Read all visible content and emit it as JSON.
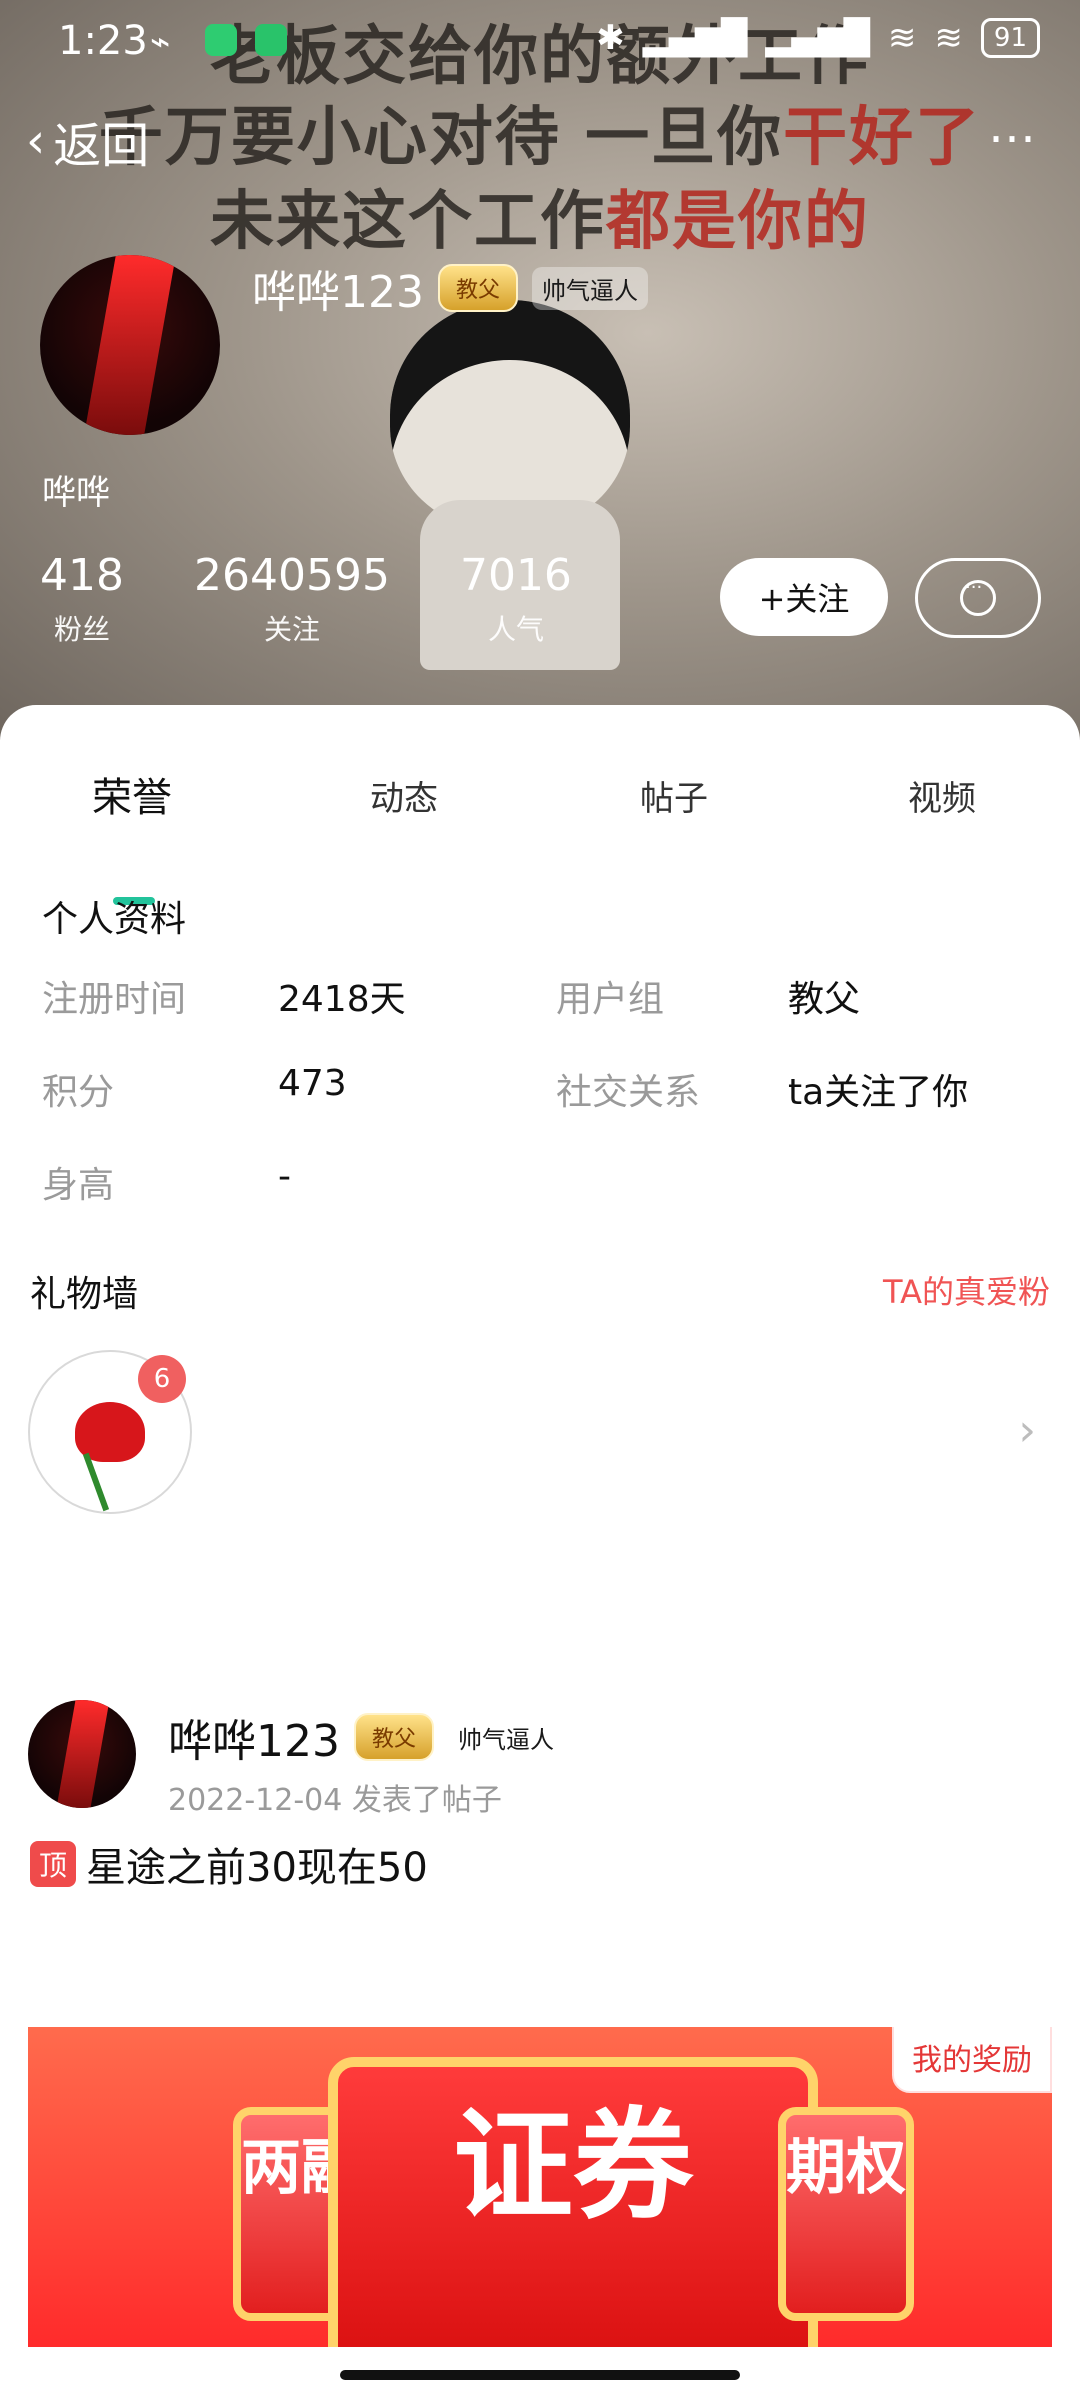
{
  "status_bar": {
    "time": "1:23",
    "battery": "91"
  },
  "nav": {
    "back_label": "返回",
    "more_label": "⋯"
  },
  "hero_text": {
    "line1": "老板交给你的额外工作",
    "line2_a": "千万要小心对待 一旦你",
    "line2_b": "干好了",
    "line3_a": "未来这个工作",
    "line3_b": "都是你的"
  },
  "profile": {
    "nickname": "哗哗123",
    "badge": "教父",
    "ink_badge": "帅气逼人",
    "small_name": "哗哗",
    "stats": [
      {
        "num": "418",
        "label": "粉丝"
      },
      {
        "num": "2640595",
        "label": "关注"
      },
      {
        "num": "7016",
        "label": "人气"
      }
    ],
    "follow_label": "+关注"
  },
  "tabs": {
    "items": [
      "荣誉",
      "动态",
      "帖子",
      "视频"
    ],
    "active_index": 0
  },
  "personal_info": {
    "title": "个人资料",
    "rows": [
      {
        "k": "注册时间",
        "v": "2418天",
        "k2": "用户组",
        "v2": "教父"
      },
      {
        "k": "积分",
        "v": "473",
        "k2": "社交关系",
        "v2": "ta关注了你"
      },
      {
        "k": "身高",
        "v": "-",
        "k2": "",
        "v2": ""
      }
    ]
  },
  "gift_wall": {
    "title": "礼物墙",
    "link": "TA的真爱粉",
    "count": "6"
  },
  "post": {
    "author": "哗哗123",
    "badge": "教父",
    "ink_badge": "帅气逼人",
    "meta": "2022-12-04  发表了帖子",
    "pin_label": "顶",
    "text": "星途之前30现在50"
  },
  "banner": {
    "reward_label": "我的奖励",
    "center_big": "证券",
    "left_side": "两融",
    "right_side": "期权"
  },
  "colors": {
    "accent": "#22c39b",
    "link_red": "#f05454",
    "pin_red": "#ef4b4b"
  }
}
